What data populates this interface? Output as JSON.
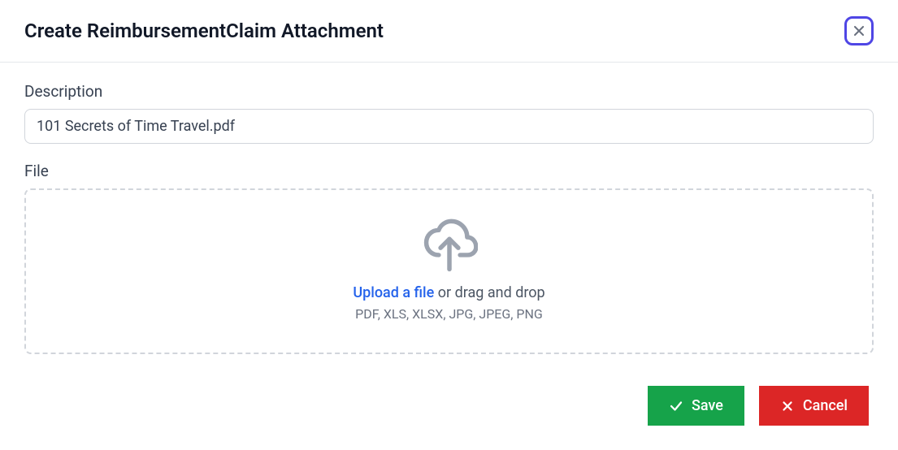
{
  "header": {
    "title": "Create ReimbursementClaim Attachment"
  },
  "form": {
    "description_label": "Description",
    "description_value": "101 Secrets of Time Travel.pdf",
    "file_label": "File",
    "upload_link_text": "Upload a file",
    "upload_suffix_text": " or drag and drop",
    "accepted_formats": "PDF, XLS, XLSX, JPG, JPEG, PNG"
  },
  "footer": {
    "save_label": "Save",
    "cancel_label": "Cancel"
  }
}
